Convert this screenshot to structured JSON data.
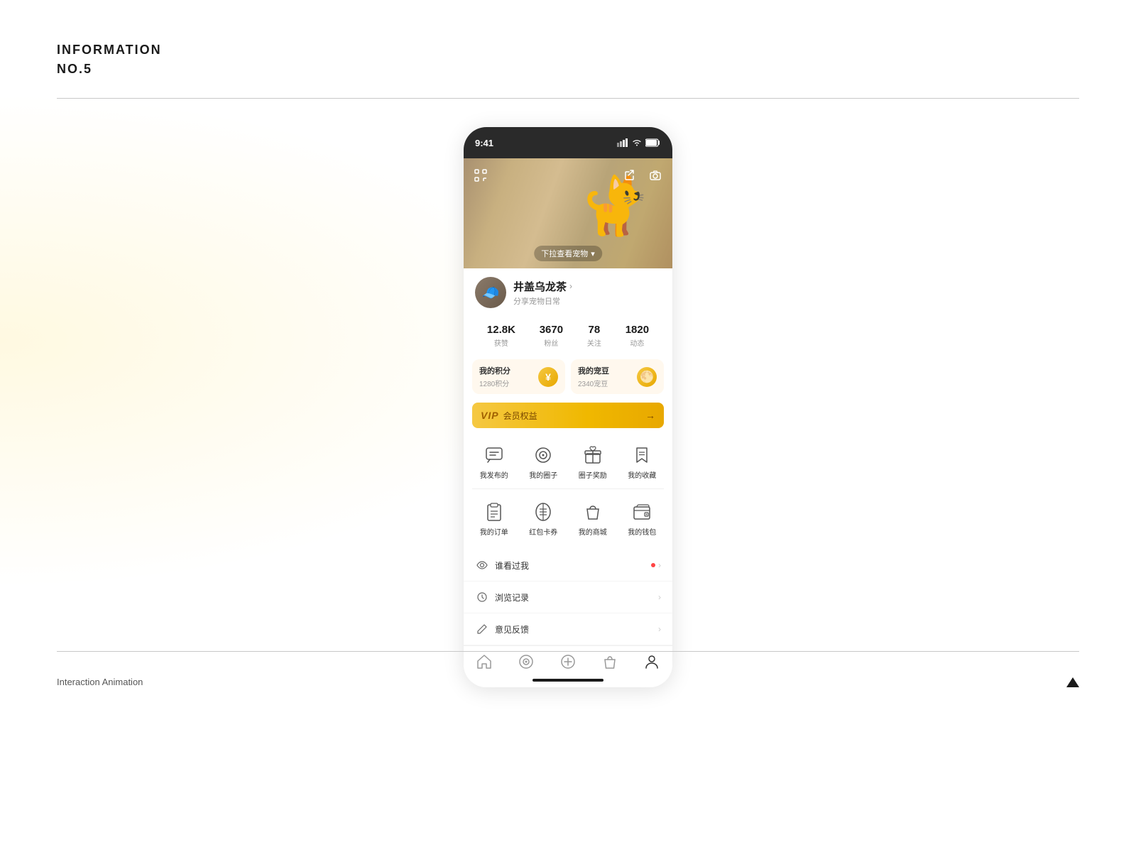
{
  "header": {
    "title": "INFORMATION",
    "number": "NO.5"
  },
  "phone": {
    "status_bar": {
      "time": "9:41"
    },
    "hero": {
      "bottom_label": "下拉查看宠物",
      "left_icon": "scan",
      "right_icons": [
        "share",
        "camera"
      ]
    },
    "profile": {
      "name": "井盖乌龙茶",
      "bio": "分享宠物日常",
      "chevron": "›",
      "avatar_emoji": "👒"
    },
    "stats": [
      {
        "value": "12.8K",
        "label": "获赞"
      },
      {
        "value": "3670",
        "label": "粉丝"
      },
      {
        "value": "78",
        "label": "关注"
      },
      {
        "value": "1820",
        "label": "动态"
      }
    ],
    "cards": [
      {
        "title": "我的积分",
        "value": "1280积分",
        "icon_type": "yuan"
      },
      {
        "title": "我的宠豆",
        "value": "2340宠豆",
        "icon_type": "bean"
      }
    ],
    "vip": {
      "vip_text": "VIP",
      "label": "会员权益",
      "arrow": "→"
    },
    "menu_row1": [
      {
        "label": "我发布的",
        "icon": "chat"
      },
      {
        "label": "我的圈子",
        "icon": "circle"
      },
      {
        "label": "圈子奖励",
        "icon": "gift"
      },
      {
        "label": "我的收藏",
        "icon": "bookmark"
      }
    ],
    "menu_row2": [
      {
        "label": "我的订单",
        "icon": "clipboard"
      },
      {
        "label": "红包卡券",
        "icon": "coupon"
      },
      {
        "label": "我的商城",
        "icon": "bag"
      },
      {
        "label": "我的钱包",
        "icon": "wallet"
      }
    ],
    "list_items": [
      {
        "label": "谁看过我",
        "icon": "eye",
        "has_dot": true,
        "has_chevron": true
      },
      {
        "label": "浏览记录",
        "icon": "clock",
        "has_dot": false,
        "has_chevron": true
      },
      {
        "label": "意见反馈",
        "icon": "pencil",
        "has_dot": false,
        "has_chevron": true
      }
    ],
    "bottom_nav": [
      {
        "icon": "home",
        "active": false
      },
      {
        "icon": "target",
        "active": false
      },
      {
        "icon": "plus-circle",
        "active": false
      },
      {
        "icon": "bag-nav",
        "active": false
      },
      {
        "icon": "person",
        "active": true
      }
    ]
  },
  "footer": {
    "label": "Interaction Animation"
  }
}
